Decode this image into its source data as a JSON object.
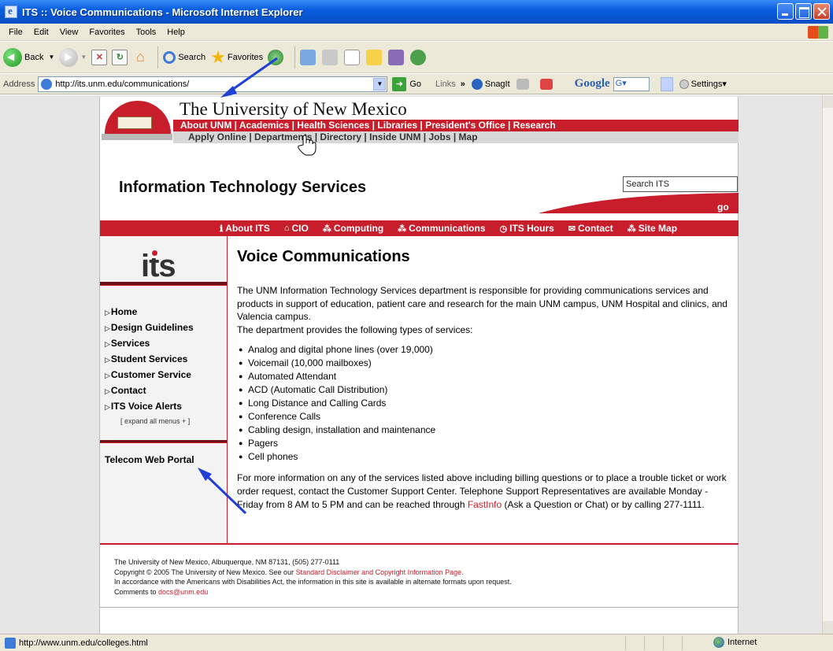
{
  "window": {
    "title": "ITS :: Voice Communications - Microsoft Internet Explorer"
  },
  "menubar": [
    "File",
    "Edit",
    "View",
    "Favorites",
    "Tools",
    "Help"
  ],
  "toolbar": {
    "back": "Back",
    "search": "Search",
    "favorites": "Favorites"
  },
  "addressbar": {
    "label": "Address",
    "url": "http://its.unm.edu/communications/",
    "go": "Go",
    "links": "Links",
    "links_chevron": "»",
    "snagit": "SnagIt",
    "google": "Google",
    "google_box": "G▾",
    "settings": "Settings▾"
  },
  "unm": {
    "title": "The University of New Mexico",
    "red_nav": "About UNM | Academics | Health Sciences | Libraries | President's Office | Research",
    "grey_nav": "Apply Online | Departments | Directory | Inside UNM | Jobs | Map"
  },
  "its": {
    "title": "Information Technology Services",
    "search_value": "Search ITS",
    "go": "go",
    "logo_text": "its"
  },
  "its_nav": [
    {
      "icon": "info-icon",
      "glyph": "ℹ",
      "label": "About ITS"
    },
    {
      "icon": "house-icon",
      "glyph": "⌂",
      "label": "CIO"
    },
    {
      "icon": "network-icon",
      "glyph": "⁂",
      "label": "Computing"
    },
    {
      "icon": "network-icon",
      "glyph": "⁂",
      "label": "Communications"
    },
    {
      "icon": "clock-icon",
      "glyph": "◷",
      "label": "ITS Hours"
    },
    {
      "icon": "envelope-icon",
      "glyph": "✉",
      "label": "Contact"
    },
    {
      "icon": "network-icon",
      "glyph": "⁂",
      "label": "Site Map"
    }
  ],
  "leftnav": {
    "items": [
      "Home",
      "Design Guidelines",
      "Services",
      "Student Services",
      "Customer Service",
      "Contact",
      "ITS Voice Alerts"
    ],
    "expand_all": "[ expand all menus + ]",
    "telecom_portal": "Telecom Web Portal"
  },
  "main": {
    "heading": "Voice Communications",
    "intro": "The UNM Information Technology Services department is responsible for providing communications services and products in support of education, patient care and research for the main UNM campus, UNM Hospital and clinics, and Valencia campus.",
    "intro2": "The department provides the following types of services:",
    "services": [
      "Analog and digital phone lines (over 19,000)",
      "Voicemail (10,000 mailboxes)",
      "Automated Attendant",
      "ACD (Automatic Call Distribution)",
      "Long Distance and Calling Cards",
      "Conference Calls",
      "Cabling design, installation and maintenance",
      "Pagers",
      "Cell phones"
    ],
    "more_info_1": "For more information on any of the services listed above including billing questions or to place a trouble ticket or work order request, contact the Customer Support Center. Telephone Support Representatives are available Monday - Friday from 8 AM to 5 PM and can be reached through ",
    "fastinfo_link": "FastInfo",
    "more_info_2": " (Ask a Question or Chat) or by calling 277-1111."
  },
  "footer": {
    "line1": "The University of New Mexico, Albuquerque, NM 87131, (505) 277-0111",
    "line2_pre": "Copyright © 2005 The University of New Mexico. See our ",
    "line2_link": "Standard Disclaimer and Copyright Information Page.",
    "line3": "In accordance with the Americans with Disabilities Act, the information in this site is available in alternate formats upon request.",
    "line4_pre": "Comments to ",
    "line4_link": "docs@unm.edu"
  },
  "statusbar": {
    "url": "http://www.unm.edu/colleges.html",
    "zone": "Internet"
  },
  "colors": {
    "unm_red": "#c81d2a",
    "annotation_arrow": "#1f3fd6"
  }
}
